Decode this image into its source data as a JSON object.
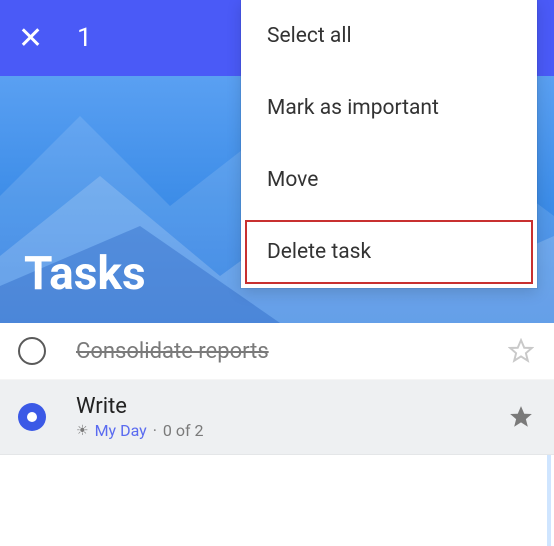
{
  "topbar": {
    "selected_count": "1"
  },
  "hero": {
    "title": "Tasks"
  },
  "menu": {
    "items": [
      {
        "label": "Select all"
      },
      {
        "label": "Mark as important"
      },
      {
        "label": "Move"
      },
      {
        "label": "Delete task"
      }
    ]
  },
  "tasks": [
    {
      "title": "Consolidate reports",
      "completed": true,
      "selected": false,
      "starred": false,
      "subtitle": null
    },
    {
      "title": "Write",
      "completed": false,
      "selected": true,
      "starred": true,
      "subtitle": {
        "myday_label": "My Day",
        "progress": "0 of 2"
      }
    }
  ]
}
